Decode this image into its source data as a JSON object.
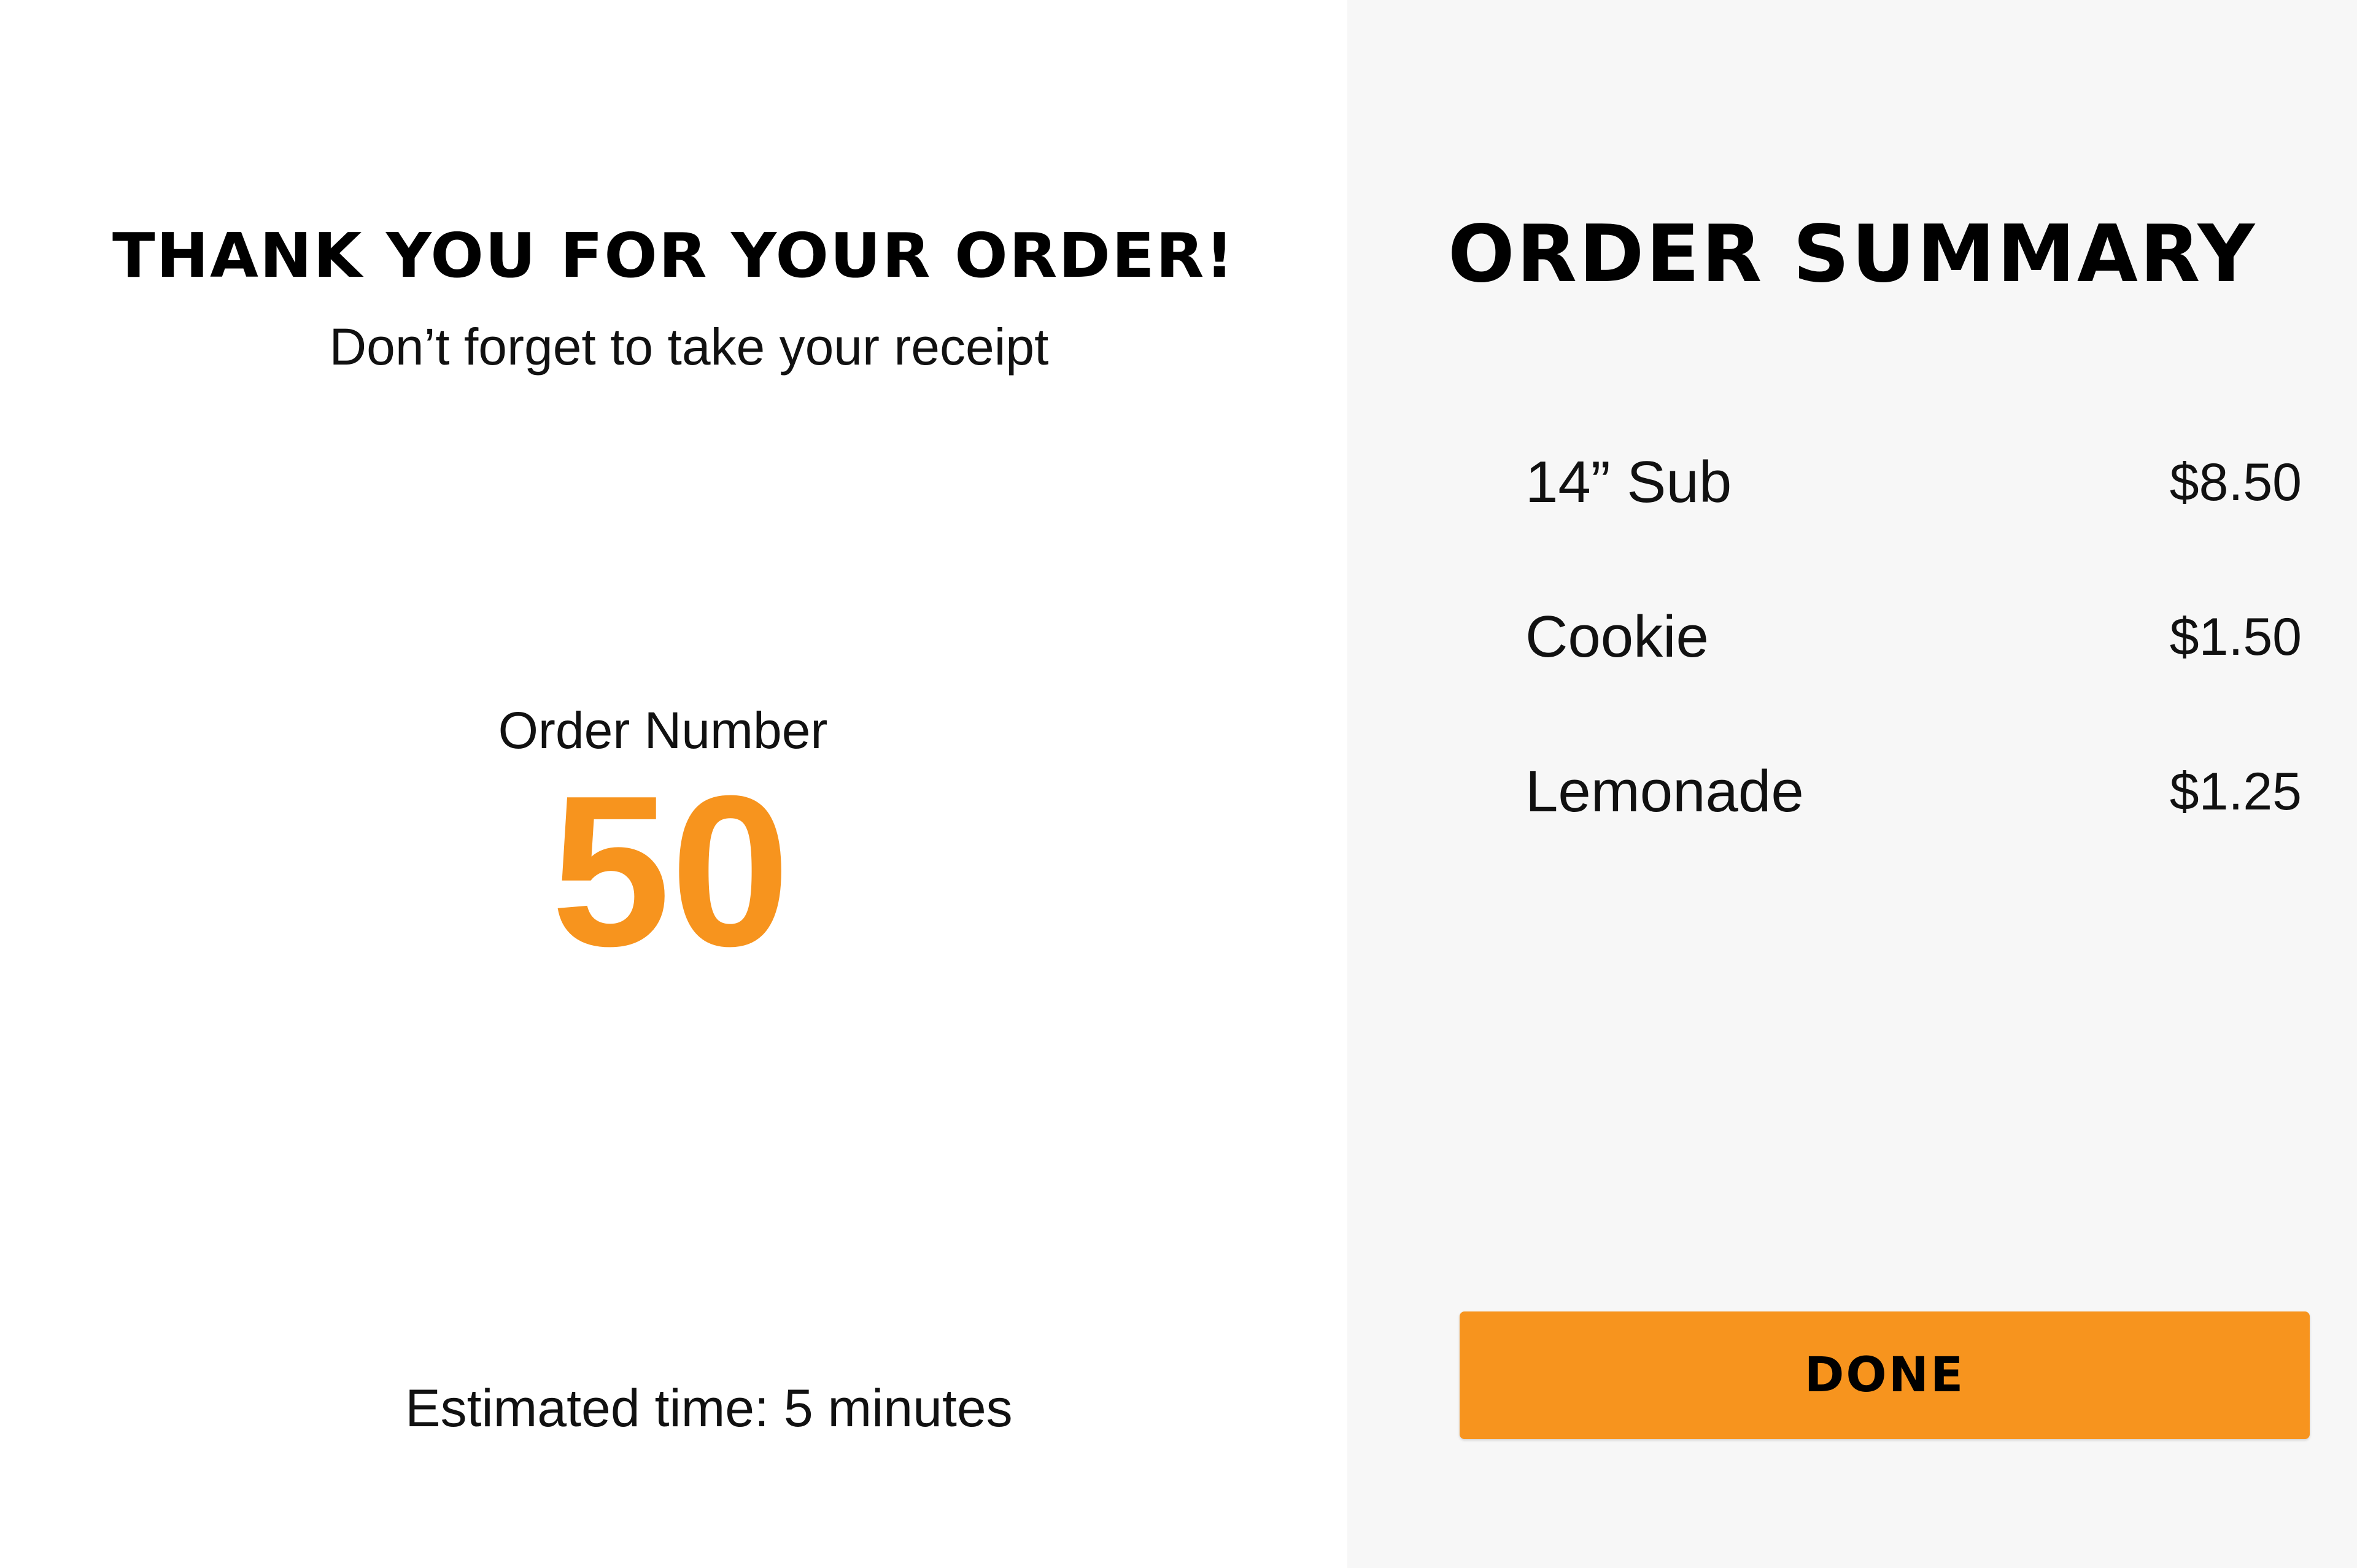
{
  "confirmation": {
    "heading": "THANK YOU FOR YOUR ORDER!",
    "receipt_note": "Don’t forget to take your receipt",
    "order_number_label": "Order Number",
    "order_number": "50",
    "estimated_time": "Estimated time: 5 minutes"
  },
  "summary": {
    "title": "ORDER SUMMARY",
    "items": [
      {
        "name": "14” Sub",
        "price": "$8.50"
      },
      {
        "name": "Cookie",
        "price": "$1.50"
      },
      {
        "name": "Lemonade",
        "price": "$1.25"
      }
    ],
    "done_label": "DONE"
  },
  "colors": {
    "accent": "#f7941e",
    "summary_background": "#f7f7f7",
    "text": "#000000"
  }
}
